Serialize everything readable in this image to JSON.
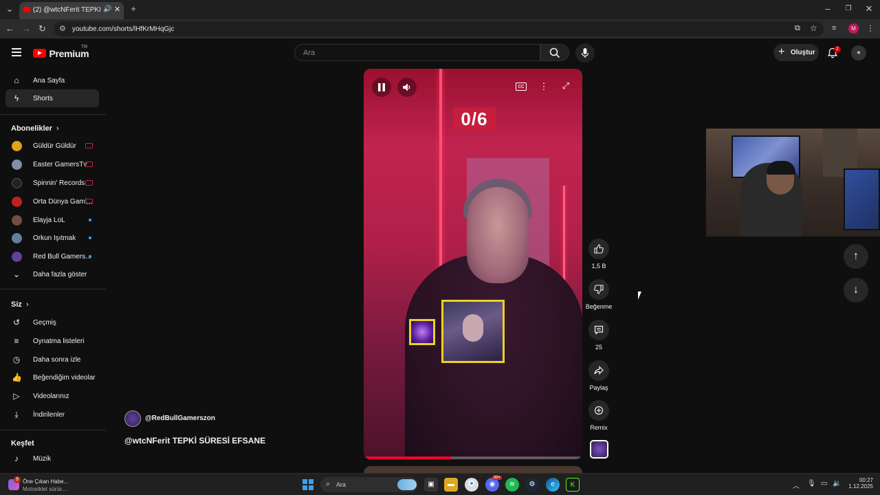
{
  "browser": {
    "tab_title": "(2) @wtcNFerit TEPKİ SÜRESİ",
    "url": "youtube.com/shorts/lHfKrMHqGjc",
    "profile_initial": "M"
  },
  "header": {
    "logo_text": "Premium",
    "logo_region": "TR",
    "search_placeholder": "Ara",
    "create_label": "Oluştur",
    "notifications_count": "2"
  },
  "sidebar": {
    "main": [
      {
        "label": "Ana Sayfa",
        "icon": "home-icon"
      },
      {
        "label": "Shorts",
        "icon": "shorts-icon",
        "active": true
      }
    ],
    "subscriptions_title": "Abonelikler",
    "subscriptions": [
      {
        "label": "Güldür Güldür",
        "status": "live",
        "color": "#e0a020"
      },
      {
        "label": "Easter GamersTv",
        "status": "live",
        "color": "#8090a8"
      },
      {
        "label": "Spinnin' Records",
        "status": "live",
        "color": "#222222"
      },
      {
        "label": "Orta Dünya Gami...",
        "status": "live",
        "color": "#c02020"
      },
      {
        "label": "Elayja LoL",
        "status": "new",
        "color": "#705040"
      },
      {
        "label": "Orkun Işıtmak",
        "status": "new",
        "color": "#6080a0"
      },
      {
        "label": "Red Bull Gamers...",
        "status": "new",
        "color": "#6040a0"
      }
    ],
    "show_more": "Daha fazla göster",
    "you_title": "Siz",
    "you_items": [
      {
        "label": "Geçmiş",
        "icon": "history-icon"
      },
      {
        "label": "Oynatma listeleri",
        "icon": "playlist-icon"
      },
      {
        "label": "Daha sonra izle",
        "icon": "clock-icon"
      },
      {
        "label": "Beğendiğim videolar",
        "icon": "like-icon"
      },
      {
        "label": "Videolarınız",
        "icon": "video-icon"
      },
      {
        "label": "İndirilenler",
        "icon": "download-icon"
      }
    ],
    "explore_title": "Keşfet",
    "explore_items": [
      {
        "label": "Müzik",
        "icon": "music-icon"
      }
    ]
  },
  "video": {
    "score_overlay": "0/6",
    "channel": "@RedBullGamerszon",
    "title": "@wtcNFerit TEPKİ SÜRESİ EFSANE",
    "progress": 0.4
  },
  "actions": {
    "likes": "1,5 B",
    "dislike_label": "Beğenme",
    "comments": "25",
    "share_label": "Paylaş",
    "remix_label": "Remix"
  },
  "taskbar": {
    "news_badge": "9",
    "news_title": "Öne Çıkan Habe...",
    "news_subtitle": "Motosiklet sürüc...",
    "search_placeholder": "Ara",
    "time": "00:27",
    "date": "1.12.2025",
    "discord_badge": "99+"
  }
}
